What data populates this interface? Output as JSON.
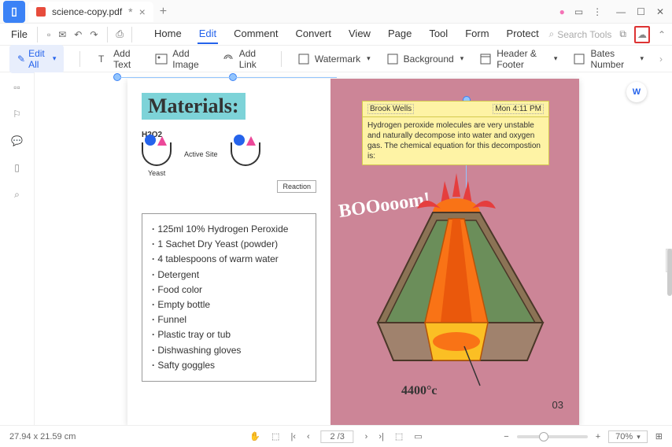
{
  "title": "science-copy.pdf",
  "file_menu": "File",
  "main_tabs": [
    "Home",
    "Edit",
    "Comment",
    "Convert",
    "View",
    "Page",
    "Tool",
    "Form",
    "Protect"
  ],
  "active_tab": 1,
  "search_placeholder": "Search Tools",
  "toolbar": {
    "edit_all": "Edit All",
    "add_text": "Add Text",
    "add_image": "Add Image",
    "add_link": "Add Link",
    "watermark": "Watermark",
    "background": "Background",
    "header_footer": "Header & Footer",
    "bates": "Bates Number"
  },
  "doc": {
    "materials_heading": "Materials:",
    "h2o2": "H2O2",
    "active_site": "Active Site",
    "yeast": "Yeast",
    "reaction": "Reaction",
    "materials": [
      "125ml 10% Hydrogen Peroxide",
      "1 Sachet Dry Yeast (powder)",
      "4 tablespoons of warm water",
      "Detergent",
      "Food color",
      "Empty bottle",
      "Funnel",
      "Plastic tray or tub",
      "Dishwashing gloves",
      "Safty goggles"
    ],
    "comment_author": "Brook Wells",
    "comment_time": "Mon 4:11 PM",
    "comment_text": "Hydrogen peroxide molecules are very unstable and naturally decompose into water and oxygen gas. The chemical equation for this decompostion is:",
    "boom": "BOOooom!",
    "temp": "4400°c",
    "page_num": "03"
  },
  "status": {
    "dims": "27.94 x 21.59 cm",
    "page": "2 /3",
    "zoom": "70%"
  }
}
